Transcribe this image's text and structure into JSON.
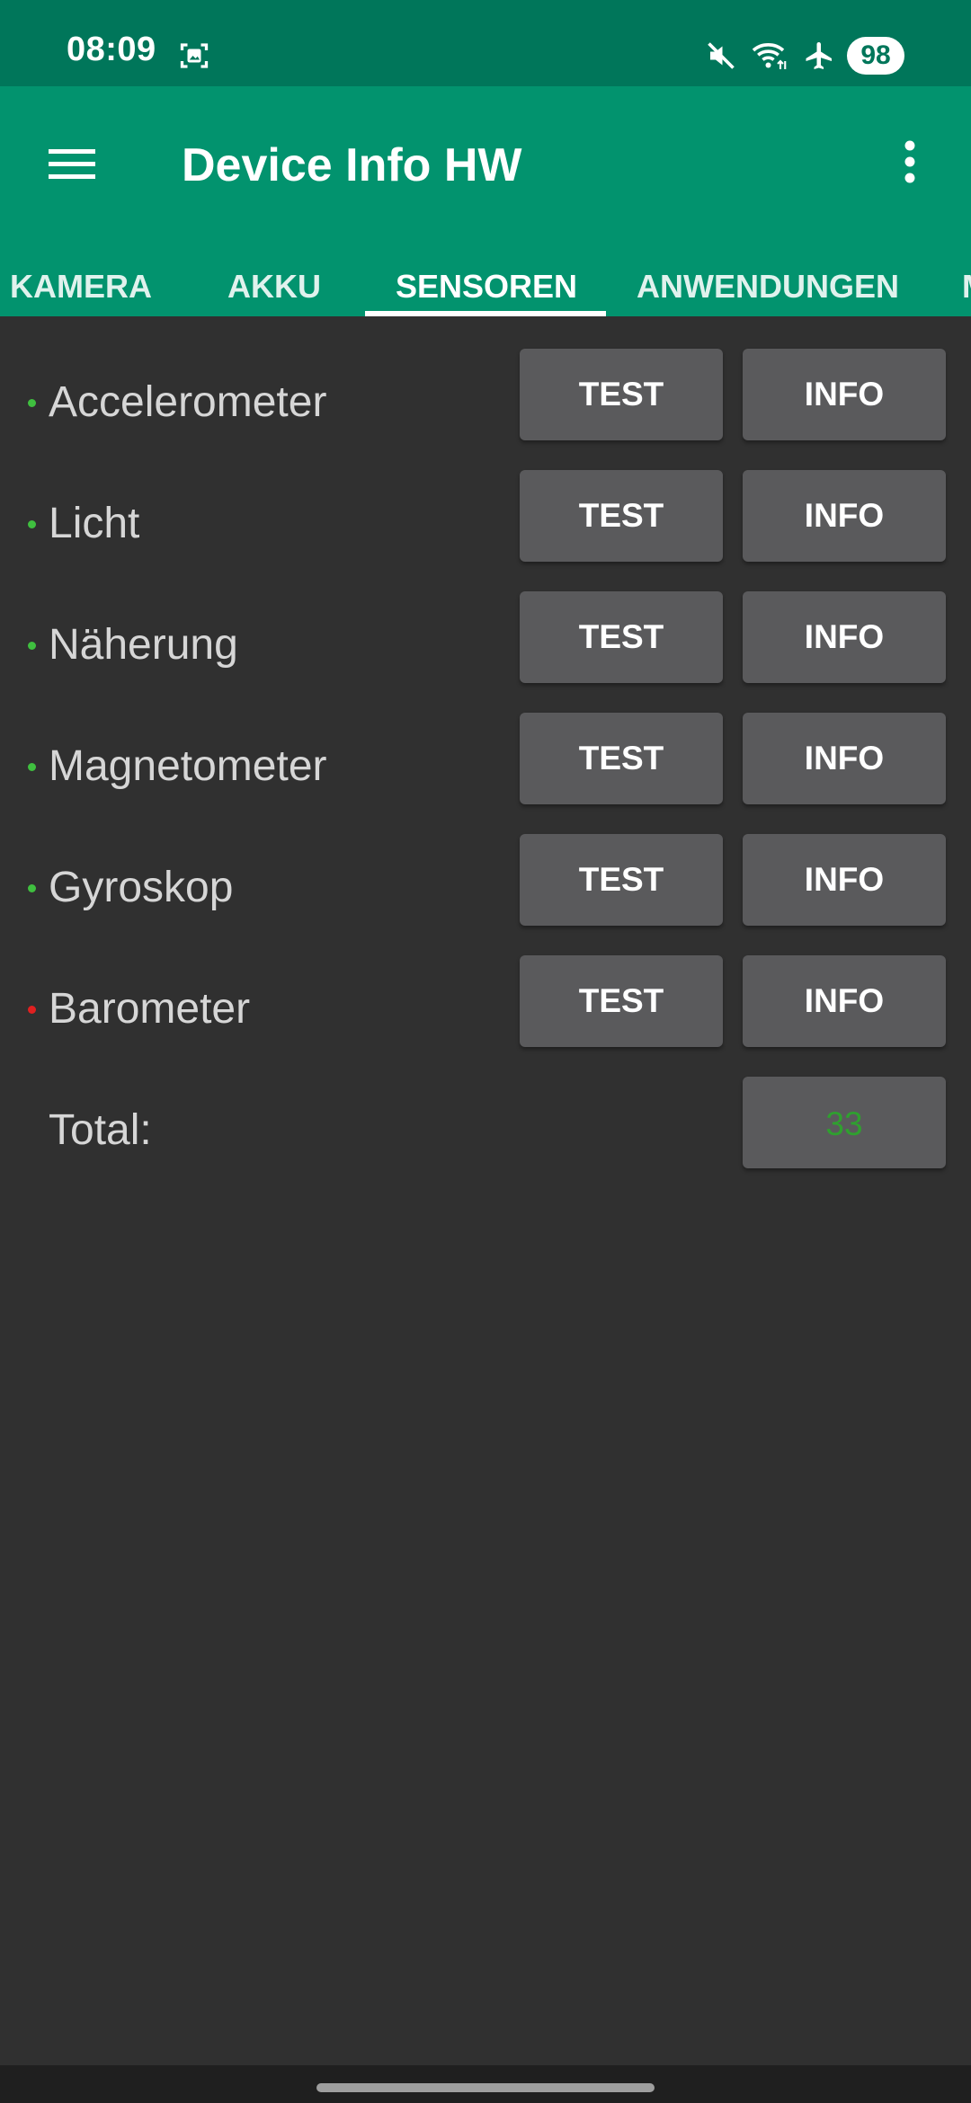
{
  "status_bar": {
    "time": "08:09",
    "battery": "98",
    "icons": [
      "screenshot-icon",
      "mute-icon",
      "wifi-icon",
      "airplane-icon"
    ]
  },
  "app_bar": {
    "title": "Device Info HW",
    "menu_icon": "hamburger-menu-icon",
    "overflow_icon": "more-vert-icon"
  },
  "tabs": [
    {
      "label": "KAMERA"
    },
    {
      "label": "AKKU"
    },
    {
      "label": "SENSOREN",
      "active": true
    },
    {
      "label": "ANWENDUNGEN"
    },
    {
      "label": "M"
    }
  ],
  "sensors": [
    {
      "name": "Accelerometer",
      "status": "available",
      "status_color": "#3fbf3f",
      "test_label": "TEST",
      "info_label": "INFO"
    },
    {
      "name": "Licht",
      "status": "available",
      "status_color": "#3fbf3f",
      "test_label": "TEST",
      "info_label": "INFO"
    },
    {
      "name": "Näherung",
      "status": "available",
      "status_color": "#3fbf3f",
      "test_label": "TEST",
      "info_label": "INFO"
    },
    {
      "name": "Magnetometer",
      "status": "available",
      "status_color": "#3fbf3f",
      "test_label": "TEST",
      "info_label": "INFO"
    },
    {
      "name": "Gyroskop",
      "status": "available",
      "status_color": "#3fbf3f",
      "test_label": "TEST",
      "info_label": "INFO"
    },
    {
      "name": "Barometer",
      "status": "unavailable",
      "status_color": "#e02020",
      "test_label": "TEST",
      "info_label": "INFO"
    }
  ],
  "total": {
    "label": "Total:",
    "value": "33",
    "value_color": "#2fa02f"
  },
  "colors": {
    "status_bar": "#00765a",
    "app_bar": "#02936e",
    "background": "#303030",
    "button": "#5a5a5c"
  }
}
